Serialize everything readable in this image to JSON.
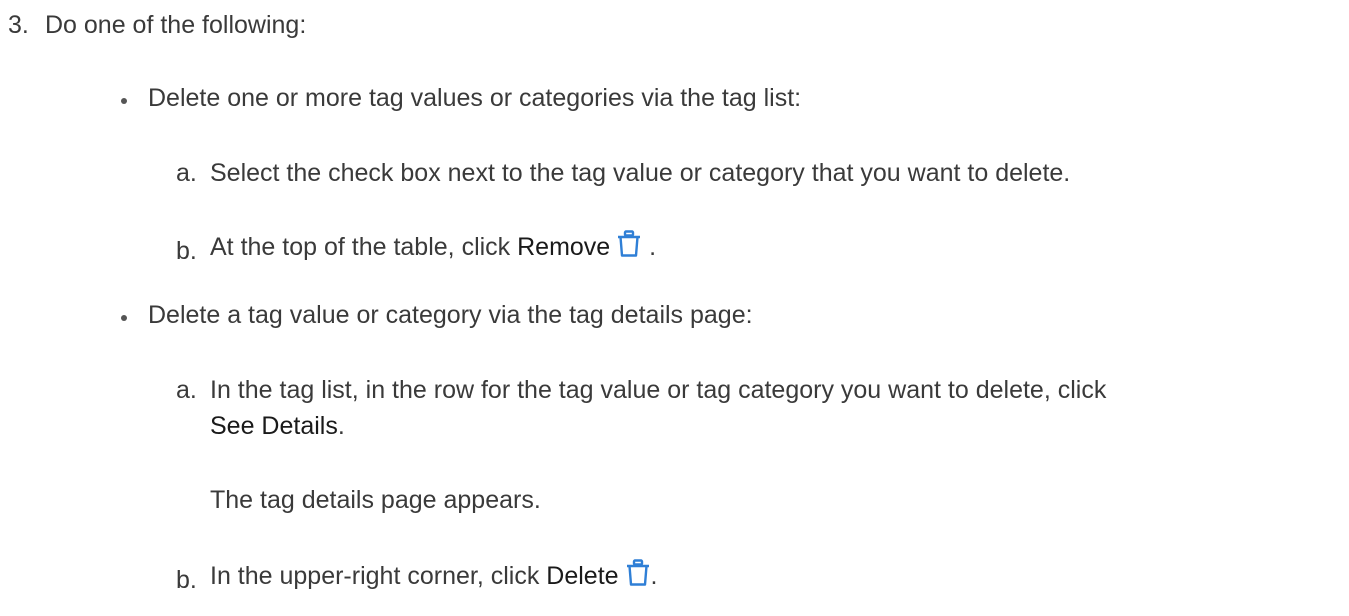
{
  "step": {
    "number": "3.",
    "text": "Do one of the following:"
  },
  "options": [
    {
      "text": "Delete one or more tag values or categories via the tag list:",
      "substeps": [
        {
          "marker": "a.",
          "text": "Select the check box next to the tag value or category that you want to delete."
        },
        {
          "marker": "b.",
          "text_before": "At the top of the table, click ",
          "ui_label": "Remove",
          "icon": "trash-icon",
          "text_after": "."
        }
      ]
    },
    {
      "text": "Delete a tag value or category via the tag details page:",
      "substeps": [
        {
          "marker": "a.",
          "text_line1": "In the tag list, in the row for the tag value or tag category you want to delete, click",
          "ui_label": "See Details",
          "text_after": ".",
          "result": "The tag details page appears."
        },
        {
          "marker": "b.",
          "text_before": "In the upper-right corner, click ",
          "ui_label": "Delete",
          "icon": "trash-icon",
          "text_after": "."
        }
      ]
    }
  ],
  "colors": {
    "text": "#3a3a3a",
    "icon": "#2f7fd6"
  }
}
